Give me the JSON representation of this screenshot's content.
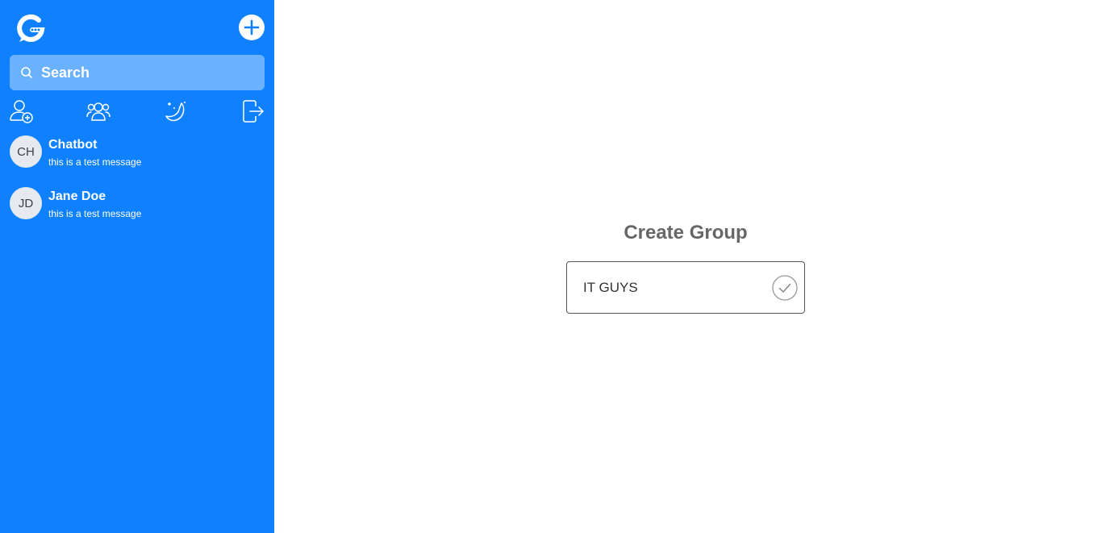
{
  "sidebar": {
    "search": {
      "placeholder": "Search"
    },
    "toolbar": [
      {
        "icon": "add-contact-icon"
      },
      {
        "icon": "group-icon"
      },
      {
        "icon": "night-mode-icon"
      },
      {
        "icon": "logout-icon"
      }
    ],
    "chats": [
      {
        "initials": "CH",
        "name": "Chatbot",
        "preview": "this is a test message"
      },
      {
        "initials": "JD",
        "name": "Jane Doe",
        "preview": "this is a test message"
      }
    ]
  },
  "main": {
    "title": "Create Group",
    "group_name_value": "IT GUYS"
  },
  "colors": {
    "sidebar_bg": "#0f81fe",
    "title": "#676767",
    "avatar_bg": "#e6e9ee"
  }
}
